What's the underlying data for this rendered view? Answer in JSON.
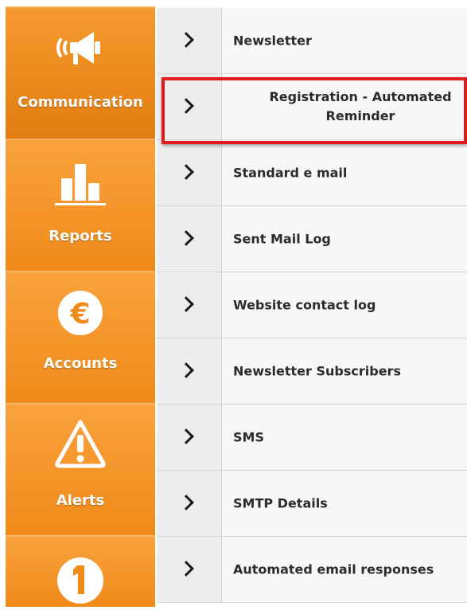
{
  "sidebar": {
    "items": [
      {
        "label": "Communication",
        "icon": "megaphone-icon",
        "active": true
      },
      {
        "label": "Reports",
        "icon": "bar-chart-icon"
      },
      {
        "label": "Accounts",
        "icon": "euro-icon"
      },
      {
        "label": "Alerts",
        "icon": "warning-icon"
      },
      {
        "label": "",
        "icon": "number-one-icon"
      }
    ]
  },
  "menu": {
    "items": [
      {
        "label": "Newsletter"
      },
      {
        "label": "Registration - Automated Reminder",
        "highlighted": true
      },
      {
        "label": "Standard e mail"
      },
      {
        "label": "Sent Mail Log"
      },
      {
        "label": "Website contact log"
      },
      {
        "label": "Newsletter Subscribers"
      },
      {
        "label": "SMS"
      },
      {
        "label": "SMTP Details"
      },
      {
        "label": "Automated email responses"
      }
    ]
  },
  "colors": {
    "sidebar_orange": "#f08a19",
    "highlight_red": "#e11a1a",
    "menu_bg": "#f7f7f7"
  }
}
